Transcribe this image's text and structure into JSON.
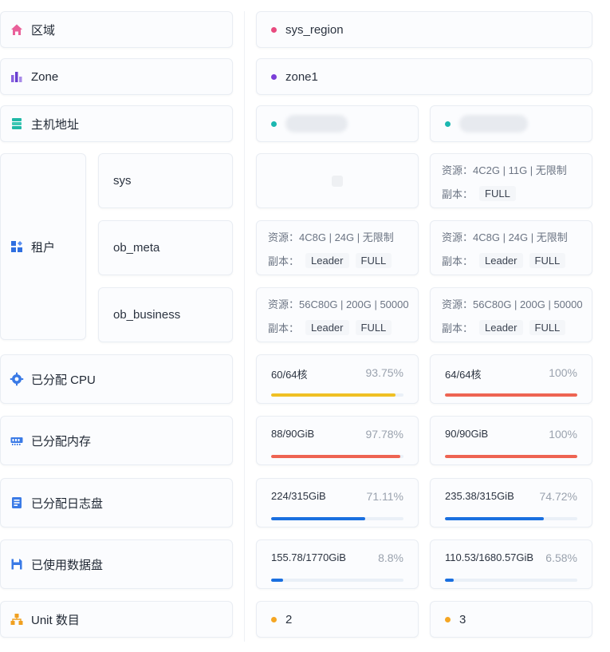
{
  "rows": {
    "region": {
      "label": "区域",
      "icon": "home-icon",
      "value": "sys_region"
    },
    "zone": {
      "label": "Zone",
      "icon": "bar-chart-icon",
      "value": "zone1"
    },
    "host": {
      "label": "主机地址",
      "icon": "server-icon"
    },
    "tenant": {
      "label": "租户",
      "icon": "grid-apps-icon",
      "names": [
        "sys",
        "ob_meta",
        "ob_business"
      ]
    },
    "cpu": {
      "label": "已分配 CPU",
      "icon": "cpu-icon"
    },
    "memory": {
      "label": "已分配内存",
      "icon": "memory-icon"
    },
    "log_disk": {
      "label": "已分配日志盘",
      "icon": "log-disk-icon"
    },
    "data_disk": {
      "label": "已使用数据盘",
      "icon": "save-disk-icon"
    },
    "unit": {
      "label": "Unit 数目",
      "icon": "hierarchy-icon"
    }
  },
  "resource_label": "资源：",
  "replica_label": "副本：",
  "servers": [
    {
      "tenants": {
        "sys": null,
        "ob_meta": {
          "resource": "4C8G | 24G | 无限制",
          "replicas": [
            "Leader",
            "FULL"
          ]
        },
        "ob_business": {
          "resource": "56C80G | 200G | 50000",
          "replicas": [
            "Leader",
            "FULL"
          ]
        }
      },
      "cpu": {
        "text": "60/64核",
        "percent": "93.75%",
        "fraction": 0.9375,
        "color": "#f0c024"
      },
      "memory": {
        "text": "88/90GiB",
        "percent": "97.78%",
        "fraction": 0.9778,
        "color": "#ee6452"
      },
      "log_disk": {
        "text": "224/315GiB",
        "percent": "71.11%",
        "fraction": 0.7111,
        "color": "#1a6fe0"
      },
      "data_disk": {
        "text": "155.78/1770GiB",
        "percent": "8.8%",
        "fraction": 0.088,
        "color": "#1a6fe0"
      },
      "unit": "2"
    },
    {
      "tenants": {
        "sys": {
          "resource": "4C2G | 11G | 无限制",
          "replicas": [
            "FULL"
          ]
        },
        "ob_meta": {
          "resource": "4C8G | 24G | 无限制",
          "replicas": [
            "Leader",
            "FULL"
          ]
        },
        "ob_business": {
          "resource": "56C80G | 200G | 50000",
          "replicas": [
            "Leader",
            "FULL"
          ]
        }
      },
      "cpu": {
        "text": "64/64核",
        "percent": "100%",
        "fraction": 1.0,
        "color": "#ee6452"
      },
      "memory": {
        "text": "90/90GiB",
        "percent": "100%",
        "fraction": 1.0,
        "color": "#ee6452"
      },
      "log_disk": {
        "text": "235.38/315GiB",
        "percent": "74.72%",
        "fraction": 0.7472,
        "color": "#1a6fe0"
      },
      "data_disk": {
        "text": "110.53/1680.57GiB",
        "percent": "6.58%",
        "fraction": 0.0658,
        "color": "#1a6fe0"
      },
      "unit": "3"
    }
  ],
  "colors": {
    "region_dot": "#e84a7f",
    "zone_dot": "#7b3fd8",
    "host_dot": "#1bb7b0",
    "unit_dot": "#f5a623"
  }
}
